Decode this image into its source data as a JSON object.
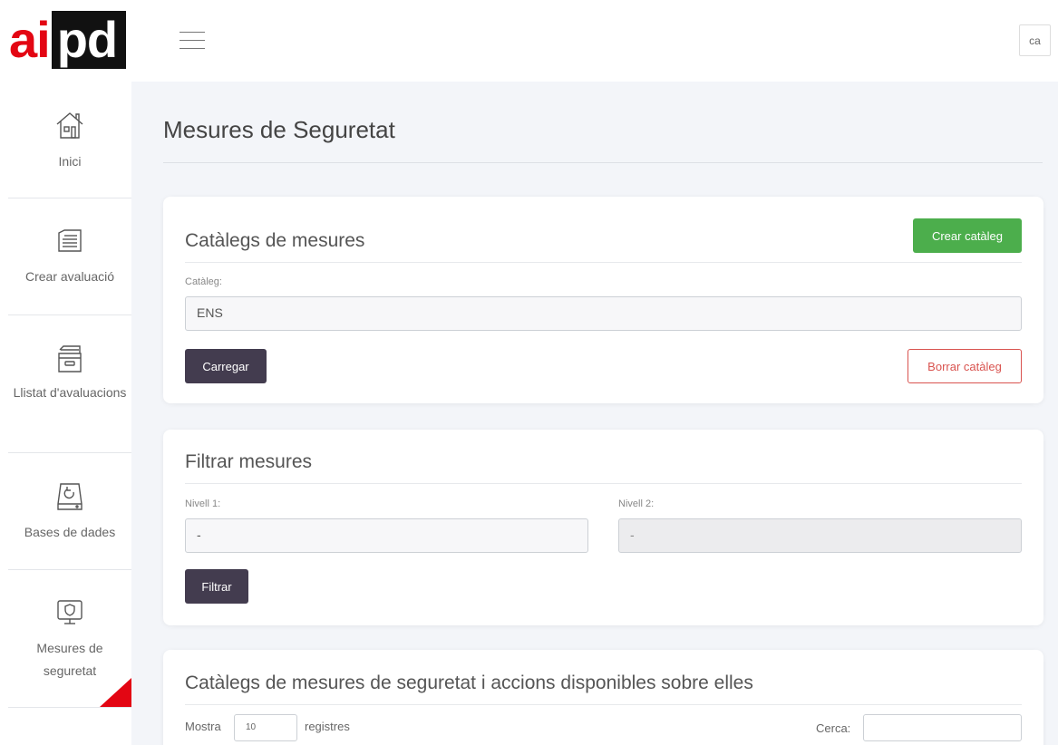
{
  "header": {
    "logo_part1": "ai",
    "logo_part2": "pd",
    "lang_label": "ca"
  },
  "sidebar": {
    "items": [
      {
        "icon": "home-icon",
        "label": "Inici"
      },
      {
        "icon": "form-icon",
        "label": "Crear avaluació"
      },
      {
        "icon": "archive-icon",
        "label": "Llistat d'avaluacions"
      },
      {
        "icon": "database-icon",
        "label": "Bases de dades"
      },
      {
        "icon": "monitor-shield-icon",
        "label": "Mesures de seguretat"
      }
    ]
  },
  "page": {
    "title": "Mesures de Seguretat"
  },
  "catalogs_card": {
    "title": "Catàlegs de mesures",
    "create_button": "Crear catàleg",
    "catalog_label": "Catàleg:",
    "catalog_value": "ENS",
    "load_button": "Carregar",
    "delete_button": "Borrar catàleg"
  },
  "filter_card": {
    "title": "Filtrar mesures",
    "level1_label": "Nivell 1:",
    "level1_value": "-",
    "level2_label": "Nivell 2:",
    "level2_value": "-",
    "filter_button": "Filtrar"
  },
  "table_card": {
    "title": "Catàlegs de mesures de seguretat i accions disponibles sobre elles",
    "show_label": "Mostra",
    "page_size": "10",
    "records_label": "registres",
    "search_label": "Cerca:",
    "search_value": ""
  },
  "colors": {
    "brand_red": "#e30613",
    "dark_button": "#433c4f",
    "green_button": "#4cae4c",
    "danger": "#d9534f"
  }
}
